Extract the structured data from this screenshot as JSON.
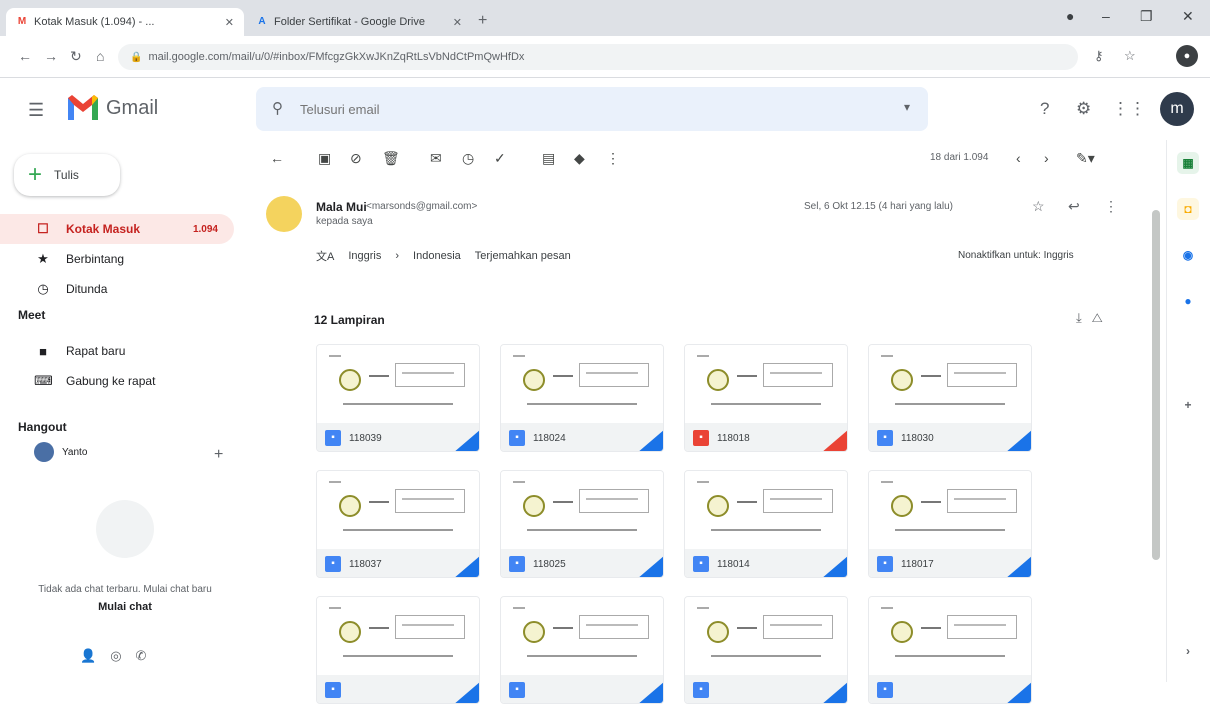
{
  "browser": {
    "tabs": [
      {
        "label": "Kotak Masuk (1.094) - ...",
        "favicon": "M"
      },
      {
        "label": "Folder Sertifikat - Google Drive",
        "favicon": "A"
      }
    ],
    "url": "mail.google.com/mail/u/0/#inbox/FMfcgzGkXwJKnZqRtLsVbNdCtPmQwHfDx"
  },
  "gmail": {
    "app_name": "Gmail",
    "search_placeholder": "Telusuri email"
  },
  "sidebar": {
    "compose_label": "Tulis",
    "items": [
      {
        "label": "Kotak Masuk",
        "count": "1.094",
        "icon": "inbox-icon"
      },
      {
        "label": "Berbintang",
        "count": "",
        "icon": "star-icon"
      },
      {
        "label": "Ditunda",
        "count": "",
        "icon": "clock-icon"
      }
    ],
    "meet_label": "Meet",
    "meet_items": [
      {
        "label": "Rapat baru",
        "icon": "video-icon"
      },
      {
        "label": "Gabung ke rapat",
        "icon": "keyboard-icon"
      }
    ],
    "hangouts_label": "Hangout",
    "hangouts_user": "Yanto",
    "no_chats_text": "Tidak ada chat terbaru. Mulai chat baru",
    "no_chats_link": "Mulai chat"
  },
  "toolbar": {
    "pager": "18 dari 1.094"
  },
  "message": {
    "sender_name": "Mala Mui",
    "sender_email": "<marsonds@gmail.com>",
    "to_me": "kepada saya",
    "date": "Sel, 6 Okt 12.15 (4 hari yang lalu)"
  },
  "translate": {
    "from": "Inggris",
    "to": "Indonesia",
    "action": "Terjemahkan pesan",
    "off": "Nonaktifkan untuk: Inggris"
  },
  "attachments": {
    "title": "12 Lampiran",
    "files": [
      {
        "name": "118039",
        "type": "blue"
      },
      {
        "name": "118024",
        "type": "blue"
      },
      {
        "name": "118018",
        "type": "red"
      },
      {
        "name": "118030",
        "type": "blue"
      },
      {
        "name": "118037",
        "type": "blue"
      },
      {
        "name": "118025",
        "type": "blue"
      },
      {
        "name": "118014",
        "type": "blue"
      },
      {
        "name": "118017",
        "type": "blue"
      },
      {
        "name": "",
        "type": "blue"
      },
      {
        "name": "",
        "type": "blue"
      },
      {
        "name": "",
        "type": "blue"
      },
      {
        "name": "",
        "type": "blue"
      }
    ]
  },
  "colors": {
    "accent_red": "#c5221f",
    "accent_blue": "#1a73e8",
    "search_bg": "#eaf1fb"
  }
}
